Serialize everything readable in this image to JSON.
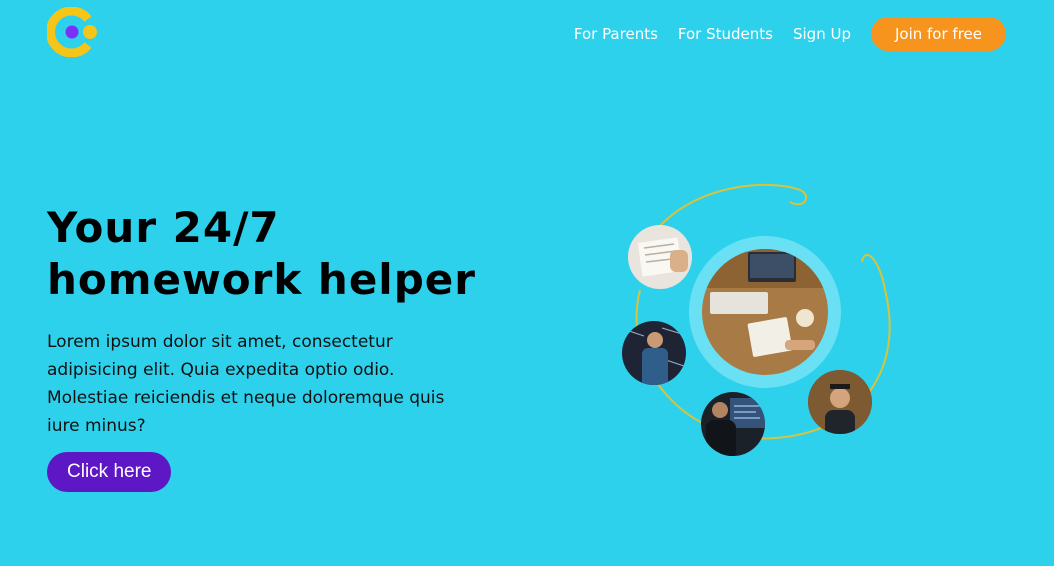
{
  "header": {
    "nav_items": [
      {
        "label": "For Parents"
      },
      {
        "label": "For Students"
      },
      {
        "label": "Sign Up"
      }
    ],
    "join_label": "Join for free"
  },
  "hero": {
    "headline_line1": "Your 24/7",
    "headline_line2": "homework helper",
    "description": "Lorem ipsum dolor sit amet, consectetur adipisicing elit. Quia expedita optio odio. Molestiae reiciendis et neque doloremque quis iure minus?",
    "cta_label": "Click here"
  },
  "colors": {
    "background": "#2dd1ec",
    "accent_orange": "#f7941d",
    "cta_purple": "#5e17c4",
    "logo_yellow": "#f5c518",
    "logo_purple": "#7b2ff7",
    "ring_gold": "#d9c33a"
  },
  "illustration": {
    "photos": [
      {
        "name": "writing-notes-photo"
      },
      {
        "name": "workspace-laptop-photo"
      },
      {
        "name": "teacher-blackboard-photo"
      },
      {
        "name": "student-computer-photo"
      },
      {
        "name": "graduate-student-photo"
      }
    ]
  }
}
